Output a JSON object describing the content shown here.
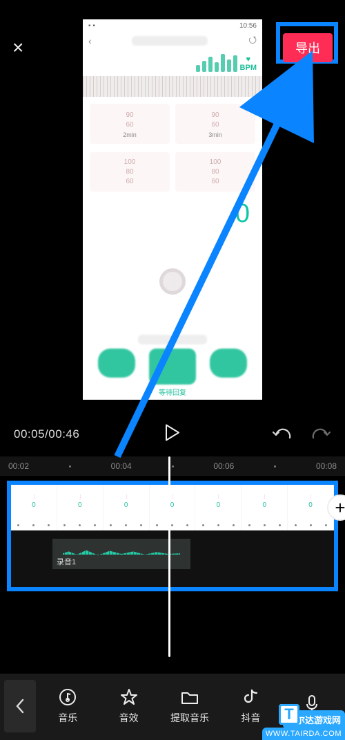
{
  "topbar": {
    "close_glyph": "×",
    "export_label": "导出"
  },
  "preview_phone": {
    "status_left": "▪ ▪",
    "status_time": "10:56",
    "back_glyph": "‹",
    "share_glyph": "⭯",
    "bpm_heart": "♥",
    "bpm_label": "BPM",
    "scale_a": [
      "90",
      "60"
    ],
    "scale_a_label": "2min",
    "scale_b": [
      "90",
      "60"
    ],
    "scale_b_label": "3min",
    "scale_c": [
      "100",
      "80",
      "60"
    ],
    "scale_d": [
      "100",
      "80",
      "60"
    ],
    "big_value": "0",
    "bottom_caption": "等待回复"
  },
  "controls": {
    "time_current": "00:05",
    "time_total": "00:46"
  },
  "ruler": {
    "ticks": [
      "00:02",
      "00:04",
      "00:06",
      "00:08"
    ]
  },
  "tracks": {
    "frame_value": "0",
    "audio_clip_label": "录音1",
    "add_glyph": "+"
  },
  "bottom_tools": [
    {
      "key": "music",
      "label": "音乐"
    },
    {
      "key": "sfx",
      "label": "音效"
    },
    {
      "key": "extract",
      "label": "提取音乐"
    },
    {
      "key": "douyin",
      "label": "抖音"
    },
    {
      "key": "record",
      "label": ""
    }
  ],
  "watermark": {
    "line1": "泰尔达游戏网",
    "line2": "WWW.TAIRDA.COM",
    "badge_letter": "T"
  }
}
